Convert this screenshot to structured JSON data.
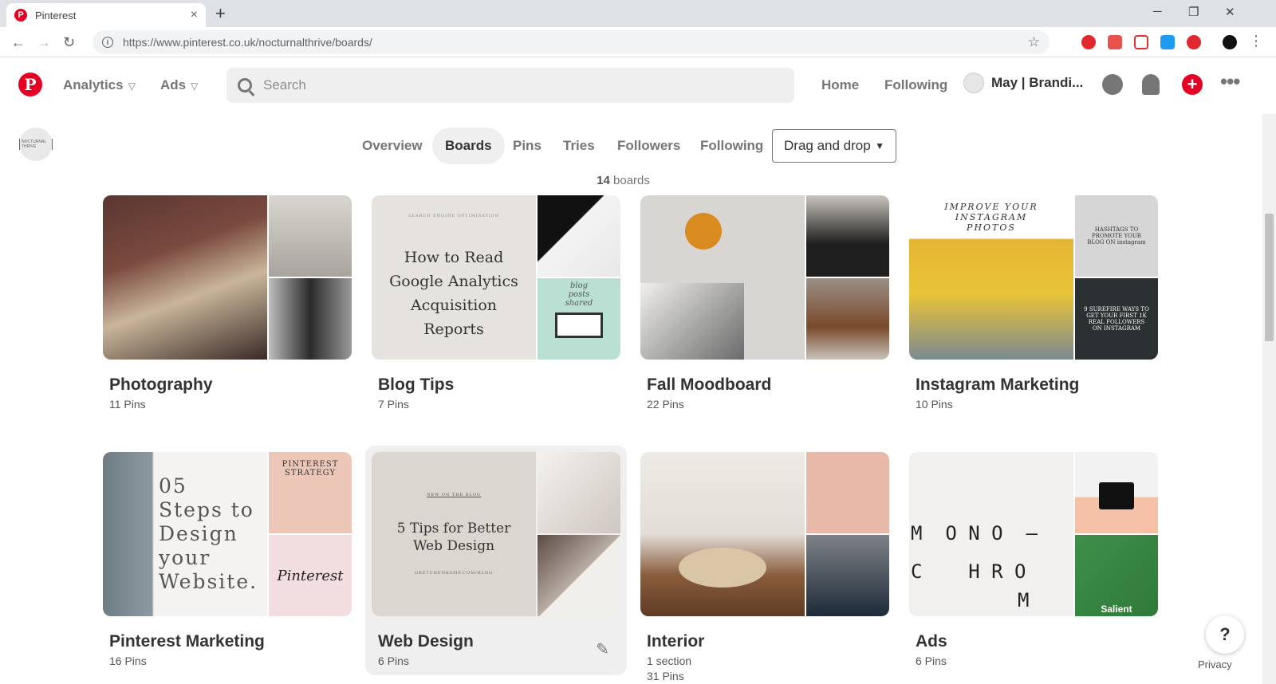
{
  "browser": {
    "tab_title": "Pinterest",
    "tab_close": "×",
    "new_tab": "+",
    "url": "https://www.pinterest.co.uk/nocturnalthrive/boards/",
    "window_controls": [
      "─",
      "❐",
      "✕"
    ]
  },
  "header": {
    "logo": "P",
    "menus": [
      {
        "label": "Analytics"
      },
      {
        "label": "Ads"
      }
    ],
    "search_placeholder": "Search",
    "nav": [
      "Home",
      "Following"
    ],
    "user_name": "May | Brandi...",
    "plus": "+",
    "more": "•••"
  },
  "profile": {
    "mini_avatar_text": "NOCTURNAL THRIVE",
    "tabs": [
      "Overview",
      "Boards",
      "Pins",
      "Tries",
      "Followers",
      "Following"
    ],
    "active_tab": "Boards",
    "sort_label": "Drag and drop",
    "board_count": "14",
    "board_count_suffix": " boards"
  },
  "boards": [
    {
      "title": "Photography",
      "pins": "11 Pins"
    },
    {
      "title": "Blog Tips",
      "pins": "7 Pins",
      "cover_text": "How to Read Google Analytics Acquisition Reports",
      "cover_small": "SEARCH ENGINE OPTIMISATION",
      "side_text": "blog posts shared"
    },
    {
      "title": "Fall Moodboard",
      "pins": "22 Pins"
    },
    {
      "title": "Instagram Marketing",
      "pins": "10 Pins",
      "cover_text": "IMPROVE YOUR INSTAGRAM PHOTOS",
      "side_top": "HASHTAGS TO PROMOTE YOUR BLOG ON instagram",
      "side_bottom": "9 SUREFIRE WAYS TO GET YOUR FIRST 1K REAL FOLLOWERS ON INSTAGRAM"
    },
    {
      "title": "Pinterest Marketing",
      "pins": "16 Pins",
      "cover_text": "05 Steps to Design your Website.",
      "side_top": "PINTEREST STRATEGY",
      "side_bottom": "Pinterest"
    },
    {
      "title": "Web Design",
      "pins": "6 Pins",
      "cover_text": "5 Tips for Better Web Design",
      "cover_small": "NEW ON THE BLOG",
      "cover_foot": "GRETCHENKAMP.COM/BLOG"
    },
    {
      "title": "Interior",
      "section": "1 section",
      "pins": "31 Pins"
    },
    {
      "title": "Ads",
      "pins": "6 Pins",
      "cover_text_1": "M  O N O  —",
      "cover_text_2": "C    H R O",
      "cover_text_3": "M",
      "side_bottom": "Salient"
    }
  ],
  "help": {
    "label": "?",
    "privacy": "Privacy"
  },
  "colors": {
    "brand": "#e60023",
    "active_tab_bg": "#efefef"
  }
}
